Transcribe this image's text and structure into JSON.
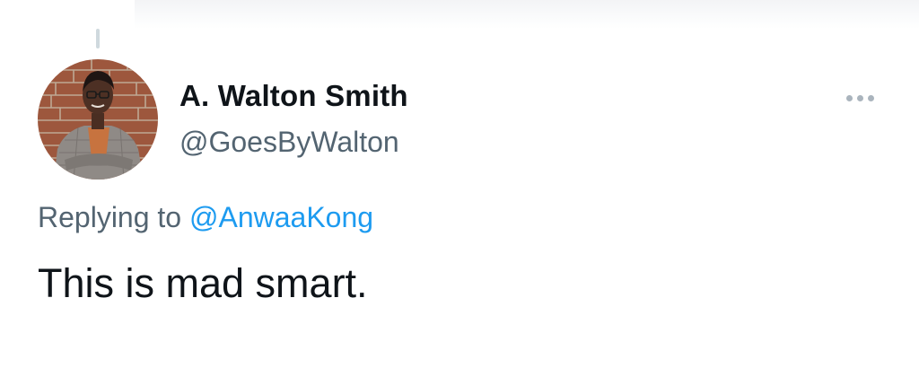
{
  "tweet": {
    "author": {
      "display_name": "A. Walton Smith",
      "handle": "@GoesByWalton",
      "avatar_icon": "profile-photo"
    },
    "reply": {
      "prefix": "Replying to",
      "mention": "@AnwaaKong"
    },
    "text": "This is mad smart.",
    "more_icon": "ellipsis-icon"
  },
  "colors": {
    "text_primary": "#0f1419",
    "text_secondary": "#536471",
    "link": "#1d9bf0",
    "thread_line": "#cfd9de"
  }
}
